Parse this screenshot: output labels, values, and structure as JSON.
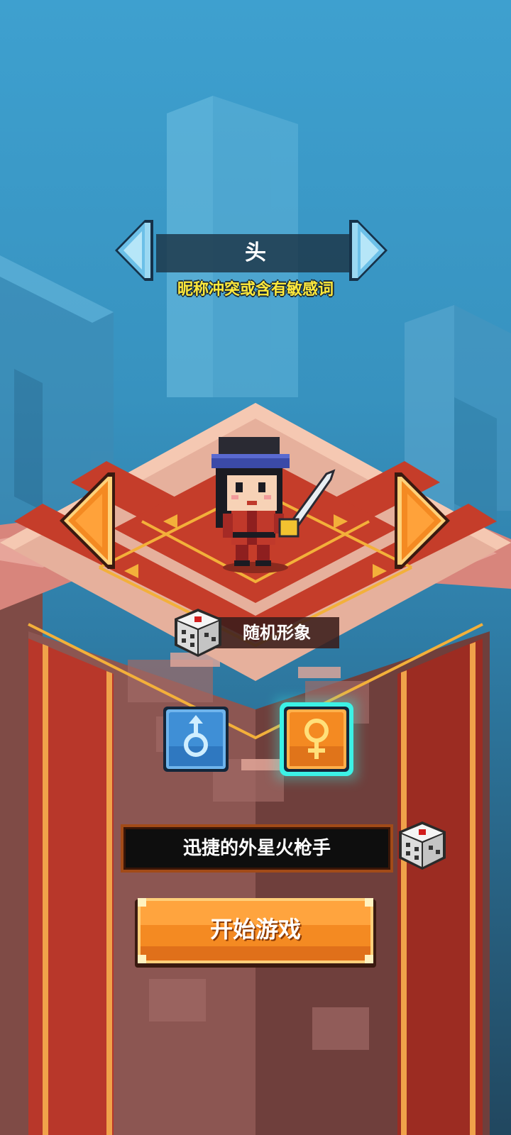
{
  "appearance": {
    "part_name": "头",
    "warning": "昵称冲突或含有敏感词",
    "random_look_label": "随机形象"
  },
  "character": {
    "name": "迅捷的外星火枪手",
    "selected_gender": "female"
  },
  "actions": {
    "start_label": "开始游戏"
  },
  "icons": {
    "part_prev": "diamond-left-arrow-icon",
    "part_next": "diamond-right-arrow-icon",
    "style_prev": "orange-left-arrow-icon",
    "style_next": "orange-right-arrow-icon",
    "dice": "dice-icon",
    "male": "male-symbol-icon",
    "female": "female-symbol-icon"
  },
  "colors": {
    "accent_orange": "#f48a22",
    "warning_yellow": "#ffe93b",
    "carpet_red": "#c53d2a",
    "male_blue": "#3f8fd6",
    "selected_glow": "#3cf2e6"
  }
}
